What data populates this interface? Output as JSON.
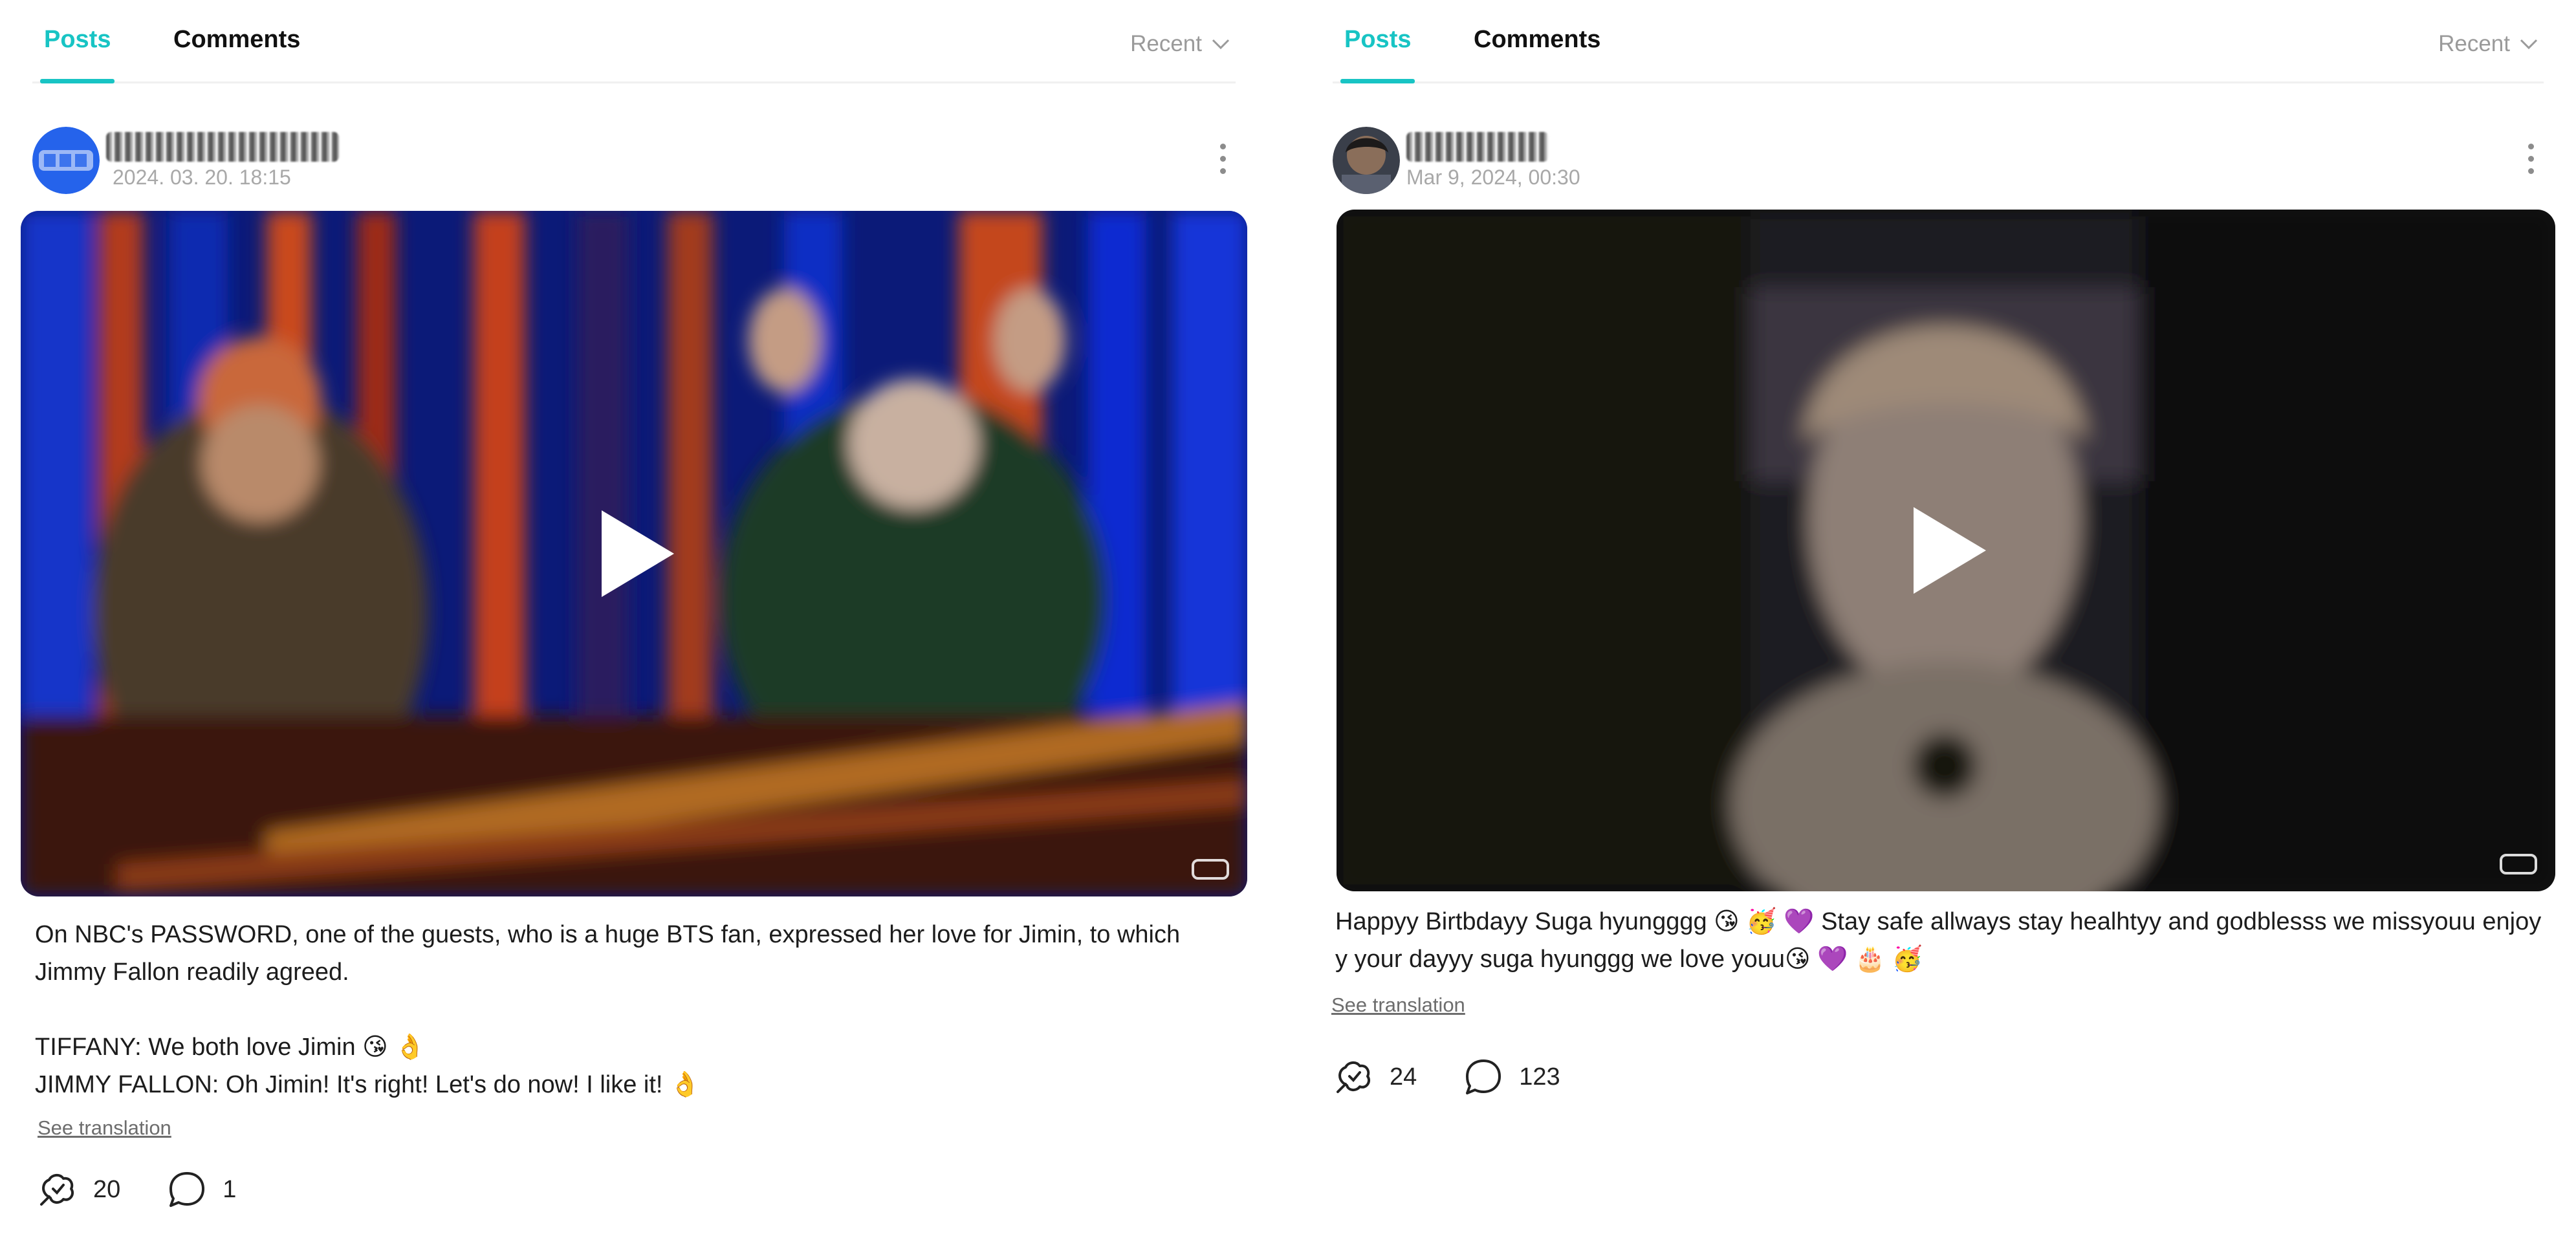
{
  "panels": [
    {
      "tabs": {
        "posts": "Posts",
        "comments": "Comments"
      },
      "sort": {
        "label": "Recent"
      },
      "post": {
        "timestamp": "2024. 03. 20. 18:15",
        "text": "On NBC's PASSWORD, one of the guests, who is a huge BTS fan, expressed her love for Jimin, to which Jimmy Fallon readily agreed.\n\nTIFFANY: We both love Jimin 😘 👌\nJIMMY FALLON: Oh Jimin! It's right! Let's do now! I like it! 👌",
        "see_translation": "See translation",
        "likes": "20",
        "comments": "1"
      }
    },
    {
      "tabs": {
        "posts": "Posts",
        "comments": "Comments"
      },
      "sort": {
        "label": "Recent"
      },
      "post": {
        "timestamp": "Mar 9, 2024, 00:30",
        "text": "Happyy Birtbdayy Suga hyungggg 😘 🥳 💜 Stay safe allways stay healhtyy and godblesss we missyouu enjoyy your dayyy suga hyunggg we love youu😘 💜 🎂 🥳",
        "see_translation": "See translation",
        "likes": "24",
        "comments": "123"
      }
    }
  ],
  "colors": {
    "accent": "#18c4c4",
    "muted": "#a8a8a8"
  },
  "icons": {
    "sort": "chevron-down-icon",
    "more": "more-vertical-icon",
    "play": "play-icon",
    "like": "cheer-icon",
    "comment": "comment-bubble-icon"
  }
}
